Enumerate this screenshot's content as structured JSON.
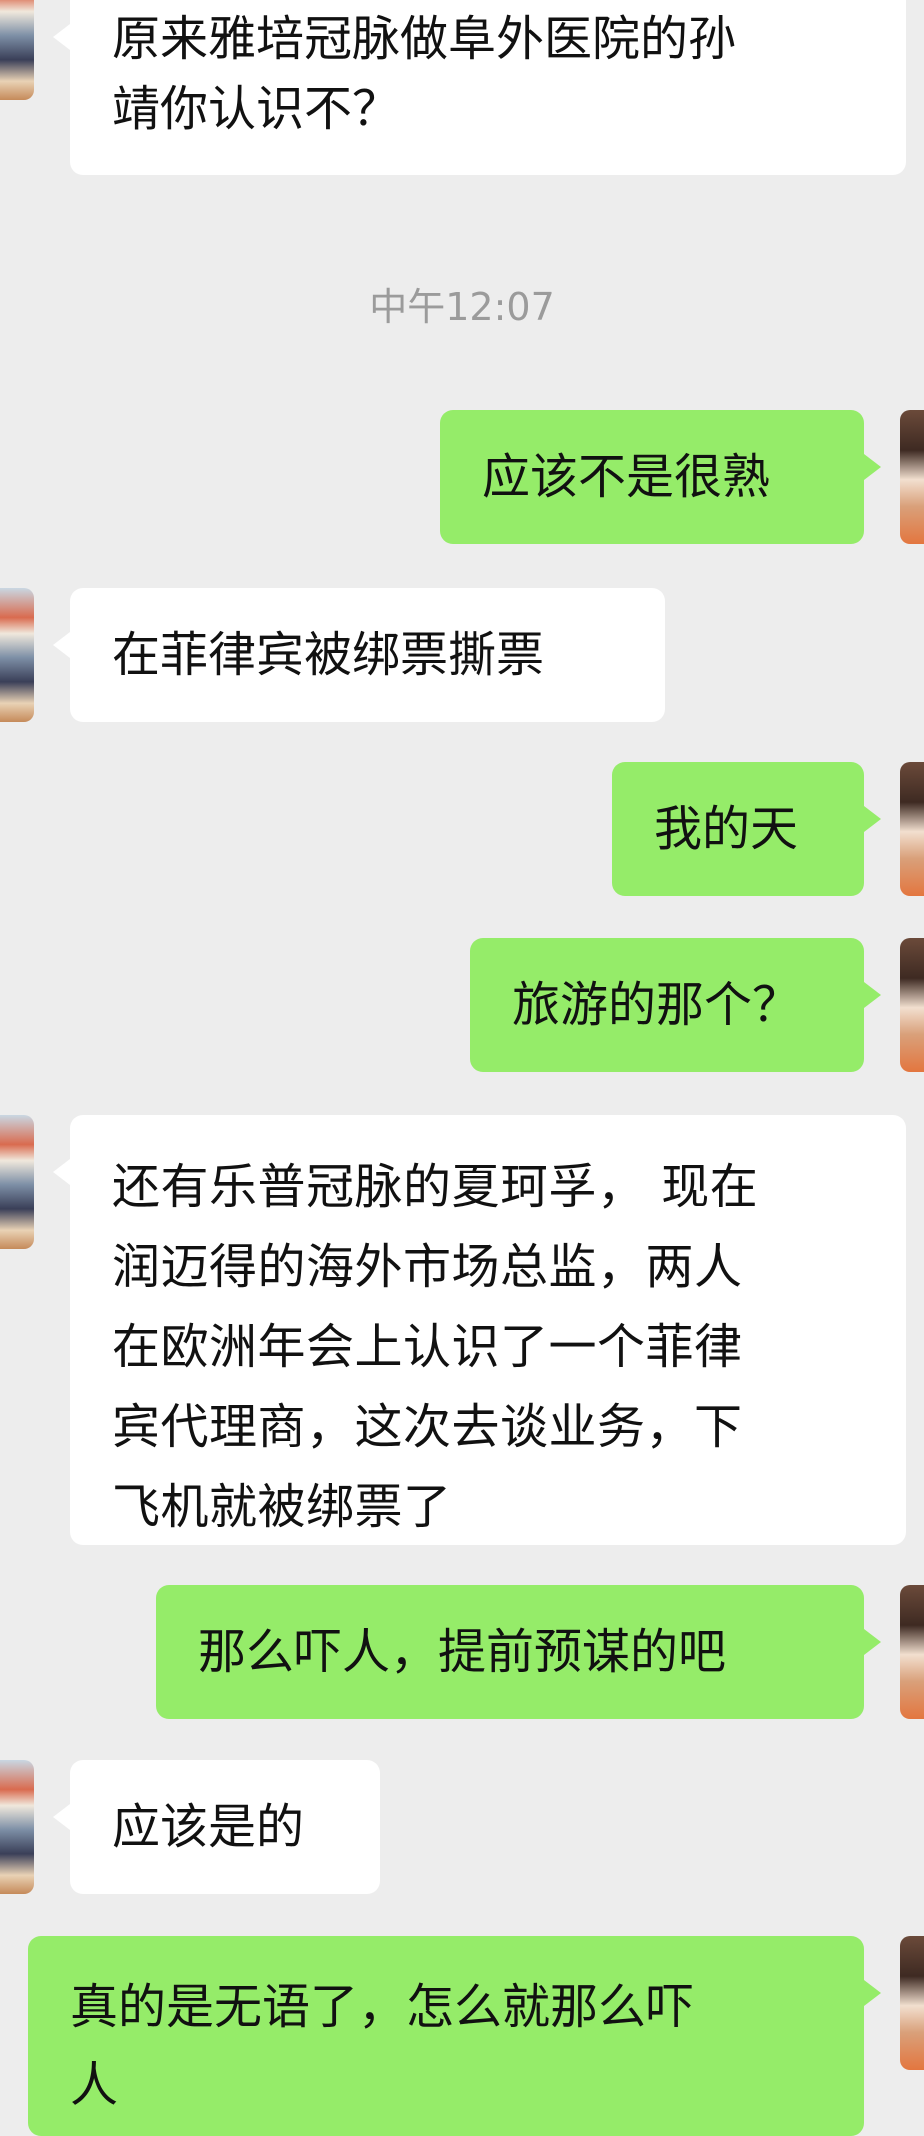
{
  "timestamp": "中午12:07",
  "messages": [
    {
      "side": "in",
      "text": "原来雅培冠脉做阜外医院的孙\n靖你认识不？"
    },
    {
      "side": "out",
      "text": "应该不是很熟"
    },
    {
      "side": "in",
      "text": "在菲律宾被绑票撕票"
    },
    {
      "side": "out",
      "text": "我的天"
    },
    {
      "side": "out",
      "text": "旅游的那个？"
    },
    {
      "side": "in",
      "text": "还有乐普冠脉的夏珂孚， 现在\n润迈得的海外市场总监，两人\n在欧洲年会上认识了一个菲律\n宾代理商，这次去谈业务，下\n飞机就被绑票了"
    },
    {
      "side": "out",
      "text": "那么吓人，提前预谋的吧"
    },
    {
      "side": "in",
      "text": "应该是的"
    },
    {
      "side": "out",
      "text": "真的是无语了，怎么就那么吓\n人"
    }
  ]
}
